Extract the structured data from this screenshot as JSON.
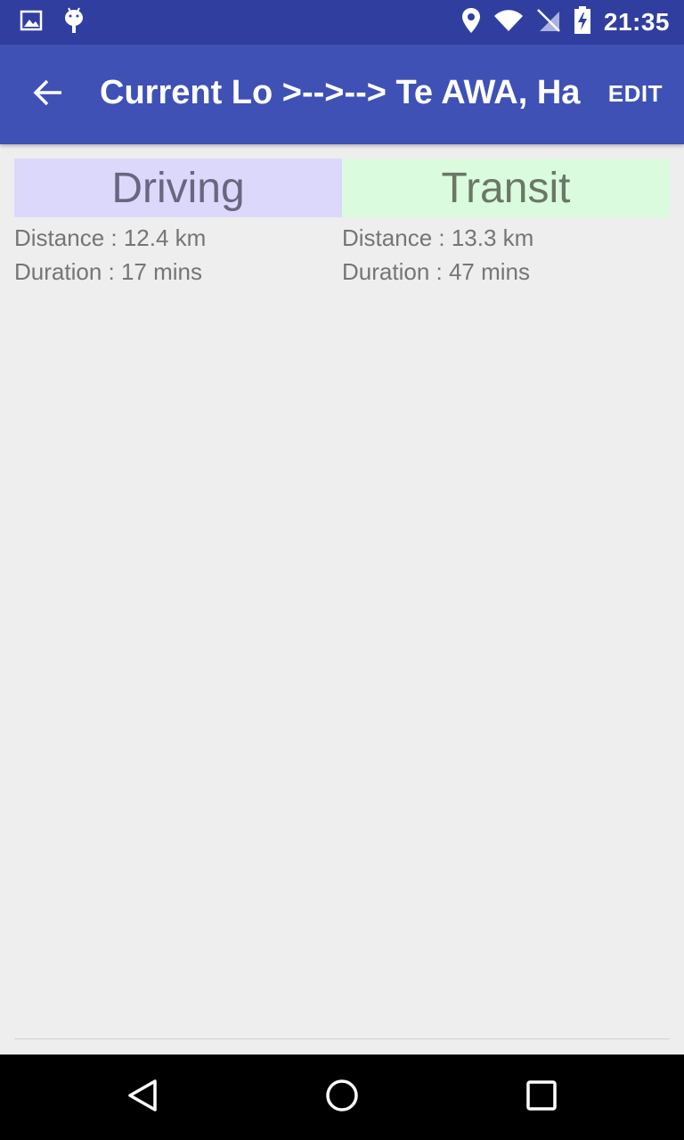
{
  "status_bar": {
    "time": "21:35",
    "left_icons": [
      "image-icon",
      "android-debug-icon"
    ],
    "right_icons": [
      "location-icon",
      "wifi-icon",
      "no-sim-icon",
      "battery-charging-icon"
    ]
  },
  "app_bar": {
    "back_icon": "arrow-back-icon",
    "title": "Current Lo >-->--> Te AWA, Ha",
    "edit_label": "EDIT",
    "color": "#3f51b5",
    "status_color": "#303f9f"
  },
  "modes": {
    "driving": {
      "label": "Driving",
      "distance": "Distance : 12.4 km",
      "duration": "Duration : 17 mins",
      "color": "#dcd8fc"
    },
    "transit": {
      "label": "Transit",
      "distance": "Distance : 13.3 km",
      "duration": "Duration : 47 mins",
      "color": "#dbfbde"
    }
  },
  "nav_bar": {
    "back_icon": "nav-back-icon",
    "home_icon": "nav-home-icon",
    "recents_icon": "nav-recents-icon"
  }
}
